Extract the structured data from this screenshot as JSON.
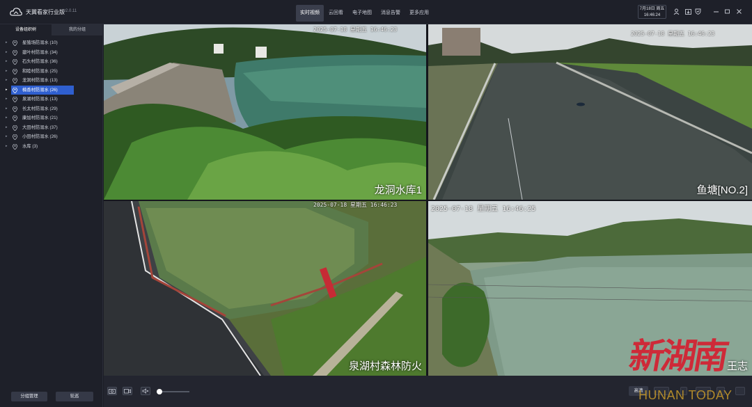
{
  "app": {
    "title": "天翼看家行业版",
    "version": "v2.0.11"
  },
  "nav": {
    "tabs": [
      "实时视频",
      "云回看",
      "电子地图",
      "消息告警",
      "更多应用"
    ],
    "active_index": 0
  },
  "datetime": {
    "date": "7月18日 周五",
    "time": "16:46:24"
  },
  "topbar_icons": [
    "user-icon",
    "download-icon",
    "shield-icon",
    "minimize-icon",
    "maximize-icon",
    "close-icon"
  ],
  "sidebar": {
    "tabs": [
      "设备组织树",
      "我的分组"
    ],
    "active_tab": 0,
    "items": [
      {
        "label": "星殖场防溺水 (10)"
      },
      {
        "label": "建叶村防溺水 (34)"
      },
      {
        "label": "石头村防溺水 (36)"
      },
      {
        "label": "和睦村防溺水 (25)"
      },
      {
        "label": "龙洞村防溺水 (13)"
      },
      {
        "label": "楠香村防溺水 (26)"
      },
      {
        "label": "泉湖村防溺水 (13)"
      },
      {
        "label": "长太村防溺水 (29)"
      },
      {
        "label": "康加村防溺水 (21)"
      },
      {
        "label": "大田村防溺水 (37)"
      },
      {
        "label": "小田村防溺水 (26)"
      },
      {
        "label": "水库 (3)"
      }
    ],
    "selected_index": 5,
    "buttons": {
      "group_manage": "分组管理",
      "carousel": "轮巡"
    }
  },
  "cameras": [
    {
      "name": "龙洞水库1",
      "timestamp": "2025-07-18 星期五 16:46:23"
    },
    {
      "name": "鱼塘[NO.2]",
      "timestamp": "2025-07-18 星期五 16:46:23"
    },
    {
      "name": "泉湖村森林防火",
      "timestamp": "2025-07-18 星期五 16:46:23"
    },
    {
      "name": "王志",
      "timestamp": "2025-07-18 星期五 16:46:25"
    }
  ],
  "active_camera_index": 1,
  "toolbar": {
    "quality": "高清",
    "volume": 0.05
  },
  "watermark": {
    "cn": "新湖南",
    "en": "HUNAN TODAY"
  },
  "colors": {
    "accent": "#2f5fcf",
    "active_border": "#3b6fe0",
    "watermark_red": "#d8192c",
    "watermark_gold": "#c99b2a"
  }
}
